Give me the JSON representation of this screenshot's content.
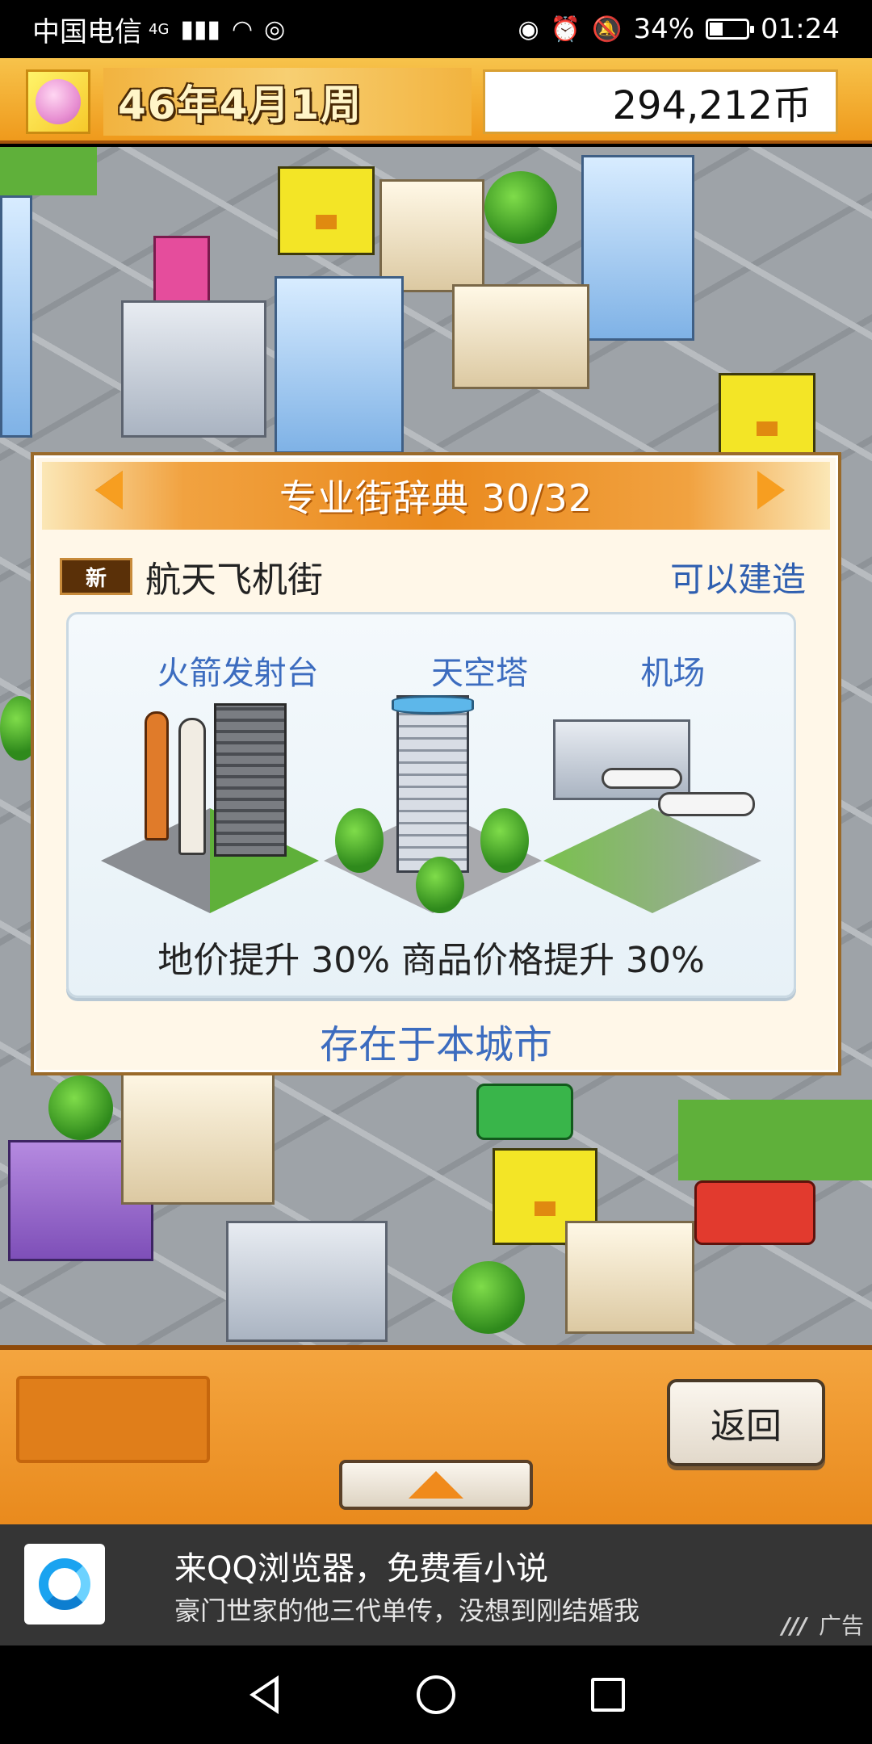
{
  "status_bar": {
    "carrier": "中国电信",
    "network": "4G",
    "battery": "34%",
    "time": "01:24"
  },
  "top_bar": {
    "date": "46年4月1周",
    "money": "294,212币"
  },
  "dialog": {
    "title": "专业街辞典 30/32",
    "badge": "新",
    "street_name": "航天飞机街",
    "status": "可以建造",
    "facilities": [
      "火箭发射台",
      "天空塔",
      "机场"
    ],
    "effect": "地价提升 30% 商品价格提升 30%",
    "existence": "存在于本城市"
  },
  "bottom_panel": {
    "back_label": "返回"
  },
  "ad": {
    "title": "来QQ浏览器，免费看小说",
    "subtitle": "豪门世家的他三代单传，没想到刚结婚我",
    "tag": "广告"
  },
  "colors": {
    "accent_orange": "#ef9a1c",
    "link_blue": "#3c6cbf"
  }
}
